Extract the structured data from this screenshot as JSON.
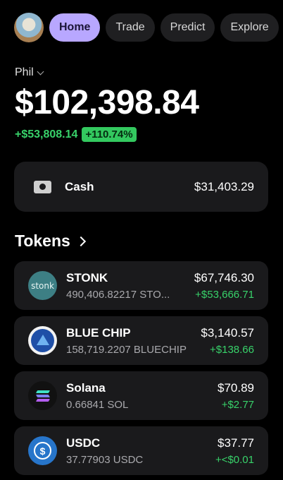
{
  "nav": {
    "tabs": [
      {
        "label": "Home",
        "active": true
      },
      {
        "label": "Trade",
        "active": false
      },
      {
        "label": "Predict",
        "active": false
      },
      {
        "label": "Explore",
        "active": false
      }
    ]
  },
  "account": {
    "name": "Phil"
  },
  "portfolio": {
    "balance": "$102,398.84",
    "change_abs": "+$53,808.14",
    "change_pct": "+110.74%"
  },
  "cash": {
    "label": "Cash",
    "value": "$31,403.29",
    "icon": "cash-icon"
  },
  "tokens_section": {
    "title": "Tokens"
  },
  "tokens": [
    {
      "name": "STONK",
      "amount": "490,406.82217 STO...",
      "value": "$67,746.30",
      "change": "+$53,666.71",
      "icon_text": "stonk",
      "icon": "stonk-token-icon"
    },
    {
      "name": "BLUE CHIP",
      "amount": "158,719.2207 BLUECHIP",
      "value": "$3,140.57",
      "change": "+$138.66",
      "icon": "bluechip-token-icon"
    },
    {
      "name": "Solana",
      "amount": "0.66841 SOL",
      "value": "$70.89",
      "change": "+$2.77",
      "icon": "solana-token-icon"
    },
    {
      "name": "USDC",
      "amount": "37.77903 USDC",
      "value": "$37.77",
      "change": "+<$0.01",
      "icon_text": "$",
      "icon": "usdc-token-icon"
    }
  ],
  "colors": {
    "accent": "#b8a7ff",
    "positive": "#38d26a",
    "card": "#1a1a1c",
    "background": "#000000"
  }
}
